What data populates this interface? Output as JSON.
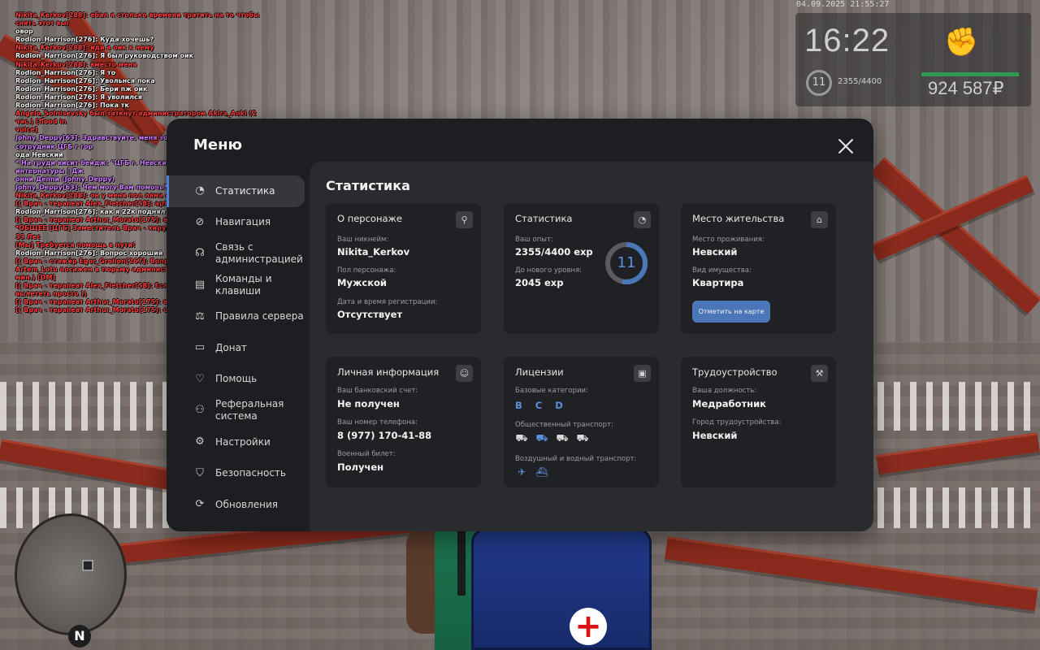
{
  "hud": {
    "date": "04.09.2025 21:55:27",
    "time": "16:22",
    "level": "11",
    "exp": "2355/4400",
    "money": "924 587₽"
  },
  "chat": [
    {
      "c": "r",
      "t": "Nikita_Kerkov[288]: ебал я столько времени тратить на то чтобы снять этот выг"
    },
    {
      "c": "w",
      "t": "овор"
    },
    {
      "c": "w",
      "t": "Rodion_Harrison[276]: Куда хочешь?"
    },
    {
      "c": "r",
      "t": "Nikita_Kerkov[288]: иди в оик к нему"
    },
    {
      "c": "w",
      "t": "Rodion_Harrison[276]: Я был руководством оик"
    },
    {
      "c": "r",
      "t": "Nikita_Kerkov[288]: вместо меня"
    },
    {
      "c": "w",
      "t": "Rodion_Harrison[276]: Я то"
    },
    {
      "c": "w",
      "t": "Rodion_Harrison[276]: Увольнся пока"
    },
    {
      "c": "w",
      "t": "Rodion_Harrison[276]: Бери пж оик"
    },
    {
      "c": "w",
      "t": "Rodion_Harrison[276]: Я уволился"
    },
    {
      "c": "w",
      "t": "Rodion_Harrison[276]: Пока тк"
    },
    {
      "c": "r",
      "t": "Angelo_Solnisevsky был заткнут администратором Akira_Aoki (2 час.) [flood in"
    },
    {
      "c": "r",
      "t": "voice]"
    },
    {
      "c": "p",
      "t": "Johny_Deppy[63]: Здравствуйте, меня зовут Джонни Деппи, я сотрудник ЦГБ г гор"
    },
    {
      "c": "w",
      "t": "ода Невский"
    },
    {
      "c": "p",
      "t": "* На груди висит бейдж: \"ЦГБ г. Невский | Интерн | Отделение интернатуры | Дж"
    },
    {
      "c": "p",
      "t": "онни Деппи (Johny_Deppy)"
    },
    {
      "c": "p",
      "t": "Johny_Deppy[63]: Чем могу Вам помочь?"
    },
    {
      "c": "r",
      "t": "Nikita_Kerkov[288]: он у меня пол ляма спиздил"
    },
    {
      "c": "r",
      "t": "[( Врач - терапевт Alex_Fletcher[58]: артур ты где ))"
    },
    {
      "c": "w",
      "t": "Rodion_Harrison[276]: как я 22к поднял 342к?"
    },
    {
      "c": "r",
      "t": "[( Врач - терапевт Arthur_Morato[175]: в погоне ))"
    },
    {
      "c": "r",
      "t": "*ОБЩЕЕ [ЦГБ] Заместитель Врач - хирург Elizabeth_Quinn[468]: 10-33 Лес"
    },
    {
      "c": "r",
      "t": "[Мы] Требуется помощь в пути!"
    },
    {
      "c": "w",
      "t": "Rodion_Harrison[276]: Вопрос хороший"
    },
    {
      "c": "r",
      "t": "[( Врач - стажёр Egor_Grollon[267]: Вопрос же ))"
    },
    {
      "c": "r",
      "t": "Artem_Lotu посажен в тюрьму администратором Akira_Aoki (30 мин.) [DM]"
    },
    {
      "c": "r",
      "t": "[( Врач - терапевт Alex_Fletcher[58]: Если что можно у меня вылететь просто ))"
    },
    {
      "c": "r",
      "t": "[( Врач - терапевт Arthur_Morato[175]: в разрешено ))"
    },
    {
      "c": "r",
      "t": "[( Врач - терапевт Arthur_Morato[175]: окей ))"
    }
  ],
  "menu": {
    "title": "Меню",
    "sidebar": [
      {
        "label": "Статистика",
        "icon": "chart-pie-icon",
        "glyph": "◔",
        "active": true
      },
      {
        "label": "Навигация",
        "icon": "compass-icon",
        "glyph": "⊘",
        "active": false
      },
      {
        "label": "Связь с администрацией",
        "icon": "headset-icon",
        "glyph": "☊",
        "active": false
      },
      {
        "label": "Команды и клавиши",
        "icon": "document-icon",
        "glyph": "▤",
        "active": false
      },
      {
        "label": "Правила сервера",
        "icon": "scales-icon",
        "glyph": "⚖",
        "active": false
      },
      {
        "label": "Донат",
        "icon": "wallet-icon",
        "glyph": "▭",
        "active": false
      },
      {
        "label": "Помощь",
        "icon": "heart-hand-icon",
        "glyph": "♡",
        "active": false
      },
      {
        "label": "Реферальная система",
        "icon": "people-network-icon",
        "glyph": "⚇",
        "active": false
      },
      {
        "label": "Настройки",
        "icon": "gear-icon",
        "glyph": "⚙",
        "active": false
      },
      {
        "label": "Безопасность",
        "icon": "shield-icon",
        "glyph": "⛉",
        "active": false
      },
      {
        "label": "Обновления",
        "icon": "refresh-check-icon",
        "glyph": "⟳",
        "active": false
      }
    ],
    "content_title": "Статистика",
    "cards": {
      "persona": {
        "title": "О персонаже",
        "icon": "user-icon",
        "fields": [
          {
            "label": "Ваш никнейм:",
            "value": "Nikita_Kerkov"
          },
          {
            "label": "Пол персонажа:",
            "value": "Мужской"
          },
          {
            "label": "Дата и время регистрации:",
            "value": "Отсутствует"
          }
        ]
      },
      "stats": {
        "title": "Статистика",
        "icon": "clock-pie-icon",
        "fields": [
          {
            "label": "Ваш опыт:",
            "value": "2355/4400 exp"
          },
          {
            "label": "До нового уровня:",
            "value": "2045 exp"
          }
        ],
        "level": "11",
        "progress": 0.535
      },
      "residence": {
        "title": "Место жительства",
        "icon": "house-icon",
        "fields": [
          {
            "label": "Место проживания:",
            "value": "Невский"
          },
          {
            "label": "Вид имущества:",
            "value": "Квартира"
          }
        ],
        "button": "Отметить на карте"
      },
      "personal": {
        "title": "Личная информация",
        "icon": "user-circle-icon",
        "fields": [
          {
            "label": "Ваш банковский счет:",
            "value": "Не получен"
          },
          {
            "label": "Ваш номер телефона:",
            "value": "8 (977) 170-41-88"
          },
          {
            "label": "Военный билет:",
            "value": "Получен"
          }
        ]
      },
      "licenses": {
        "title": "Лицензии",
        "icon": "id-card-icon",
        "base_label": "Базовые категории:",
        "base_categories": "B C D",
        "public_label": "Общественный транспорт:",
        "air_water_label": "Воздушный и водный транспорт:"
      },
      "employment": {
        "title": "Трудоустройство",
        "icon": "hammer-icon",
        "fields": [
          {
            "label": "Ваша должность:",
            "value": "Медработник"
          },
          {
            "label": "Город трудоустройства:",
            "value": "Невский"
          }
        ]
      }
    }
  },
  "colors": {
    "accent": "#4b76b8",
    "ring": "#5d8fe0",
    "panel": "#1d1e21",
    "card": "#202124"
  }
}
